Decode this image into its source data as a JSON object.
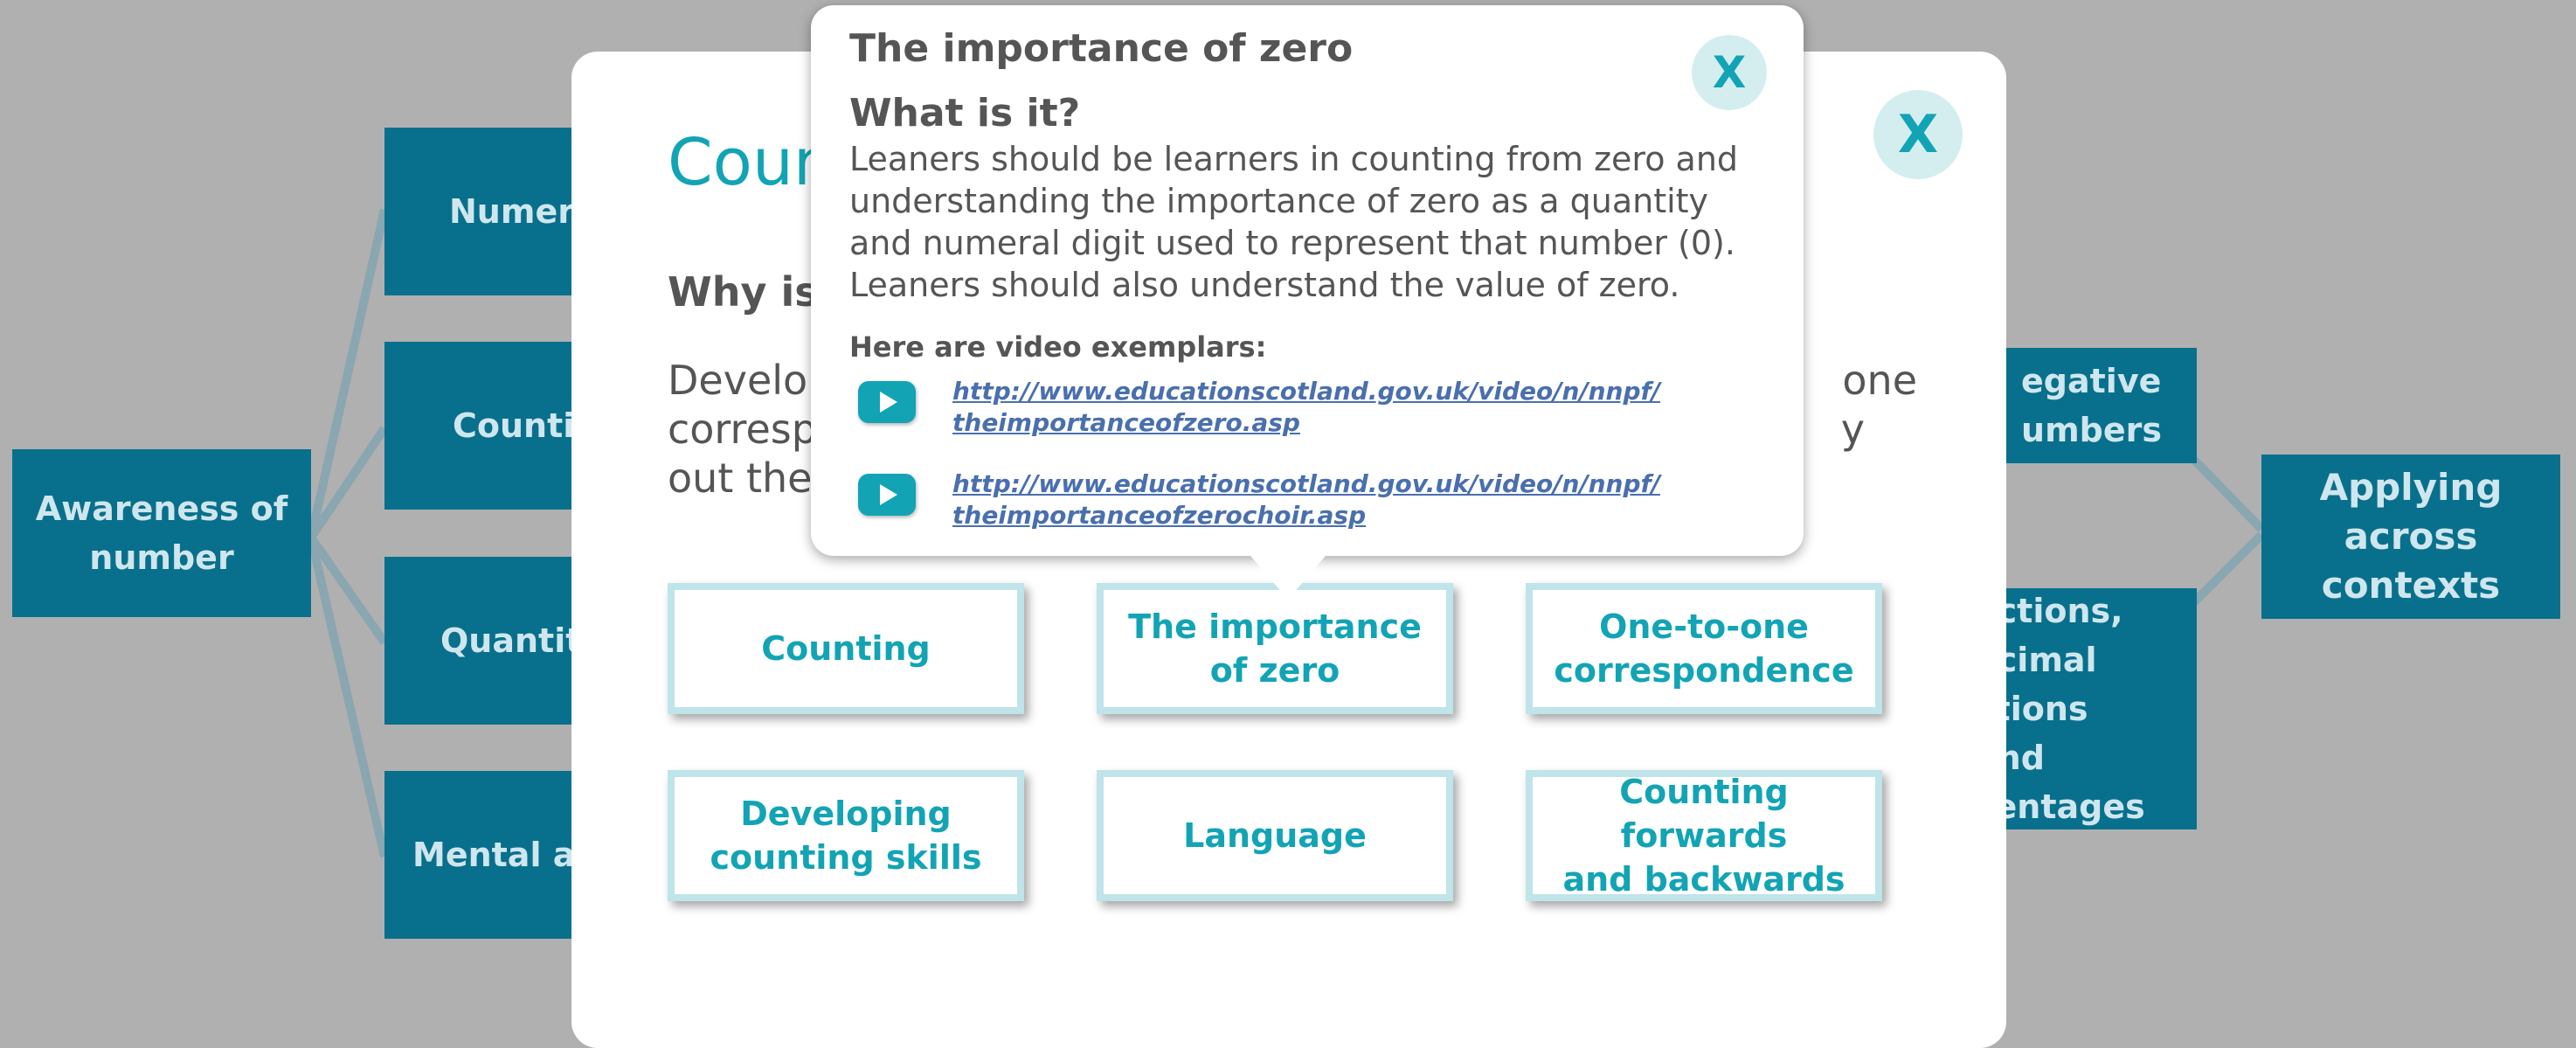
{
  "background": {
    "root": {
      "line1": "Awareness of",
      "line2": "number"
    },
    "left_nodes": [
      "Numer",
      "Counti",
      "Quantit",
      "Mental ag"
    ],
    "right_nodes": [
      {
        "line1": "egative",
        "line2": "umbers"
      },
      {
        "line1": "actions,",
        "line2": "ecimal",
        "line3": "ctions and",
        "line4": "centages"
      }
    ],
    "applying": {
      "line1": "Applying",
      "line2": "across",
      "line3": "contexts"
    }
  },
  "modal": {
    "title": "Coun",
    "subtitle": "Why is",
    "body_line1": "Develop",
    "body_line1_tail": "one",
    "body_line2": "corresp",
    "body_line2_tail": "y",
    "body_line3": "out the",
    "close_label": "X",
    "cards": [
      {
        "line1": "Counting",
        "line2": ""
      },
      {
        "line1": "The importance",
        "line2": "of zero"
      },
      {
        "line1": "One-to-one",
        "line2": "correspondence"
      },
      {
        "line1": "Developing",
        "line2": "counting skills"
      },
      {
        "line1": "Language",
        "line2": ""
      },
      {
        "line1": "Counting forwards",
        "line2": "and backwards"
      }
    ]
  },
  "popup": {
    "title": "The importance of zero",
    "subtitle": "What is it?",
    "body": "Leaners should be learners in counting from zero and understanding the importance of zero as a quantity and numeral digit used to represent that number (0). Leaners should also understand the value of zero.",
    "video_heading": "Here are video exemplars:",
    "close_label": "X",
    "videos": [
      {
        "line1": "http://www.educationscotland.gov.uk/video/n/nnpf/",
        "line2": "theimportanceofzero.asp",
        "icon": "youtube-play-icon"
      },
      {
        "line1": "http://www.educationscotland.gov.uk/video/n/nnpf/",
        "line2": "theimportanceofzerochoir.asp",
        "icon": "youtube-play-icon"
      }
    ]
  },
  "colors": {
    "node": "#08708c",
    "accent": "#12a4b4",
    "overlay": "#b0b0b0",
    "link": "#4a6fae"
  }
}
